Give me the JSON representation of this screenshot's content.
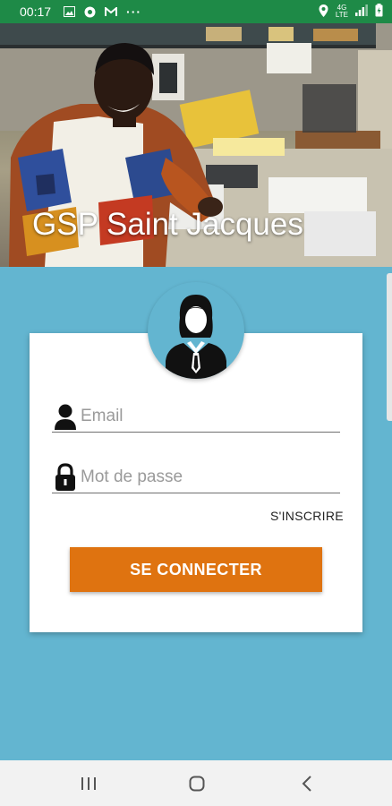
{
  "status_bar": {
    "time": "00:17",
    "more_indicator": "···",
    "network_type_top": "4G",
    "network_type_bottom": "LTE"
  },
  "hero": {
    "title": "GSP Saint Jacques"
  },
  "login": {
    "email_placeholder": "Email",
    "password_placeholder": "Mot de passe",
    "signup_label": "S'INSCRIRE",
    "submit_label": "SE CONNECTER"
  },
  "colors": {
    "status_bar": "#1e8a47",
    "background": "#63b5d0",
    "primary_button": "#df7310"
  },
  "icons": {
    "avatar": "user-avatar-icon",
    "email": "person-icon",
    "password": "lock-icon"
  }
}
